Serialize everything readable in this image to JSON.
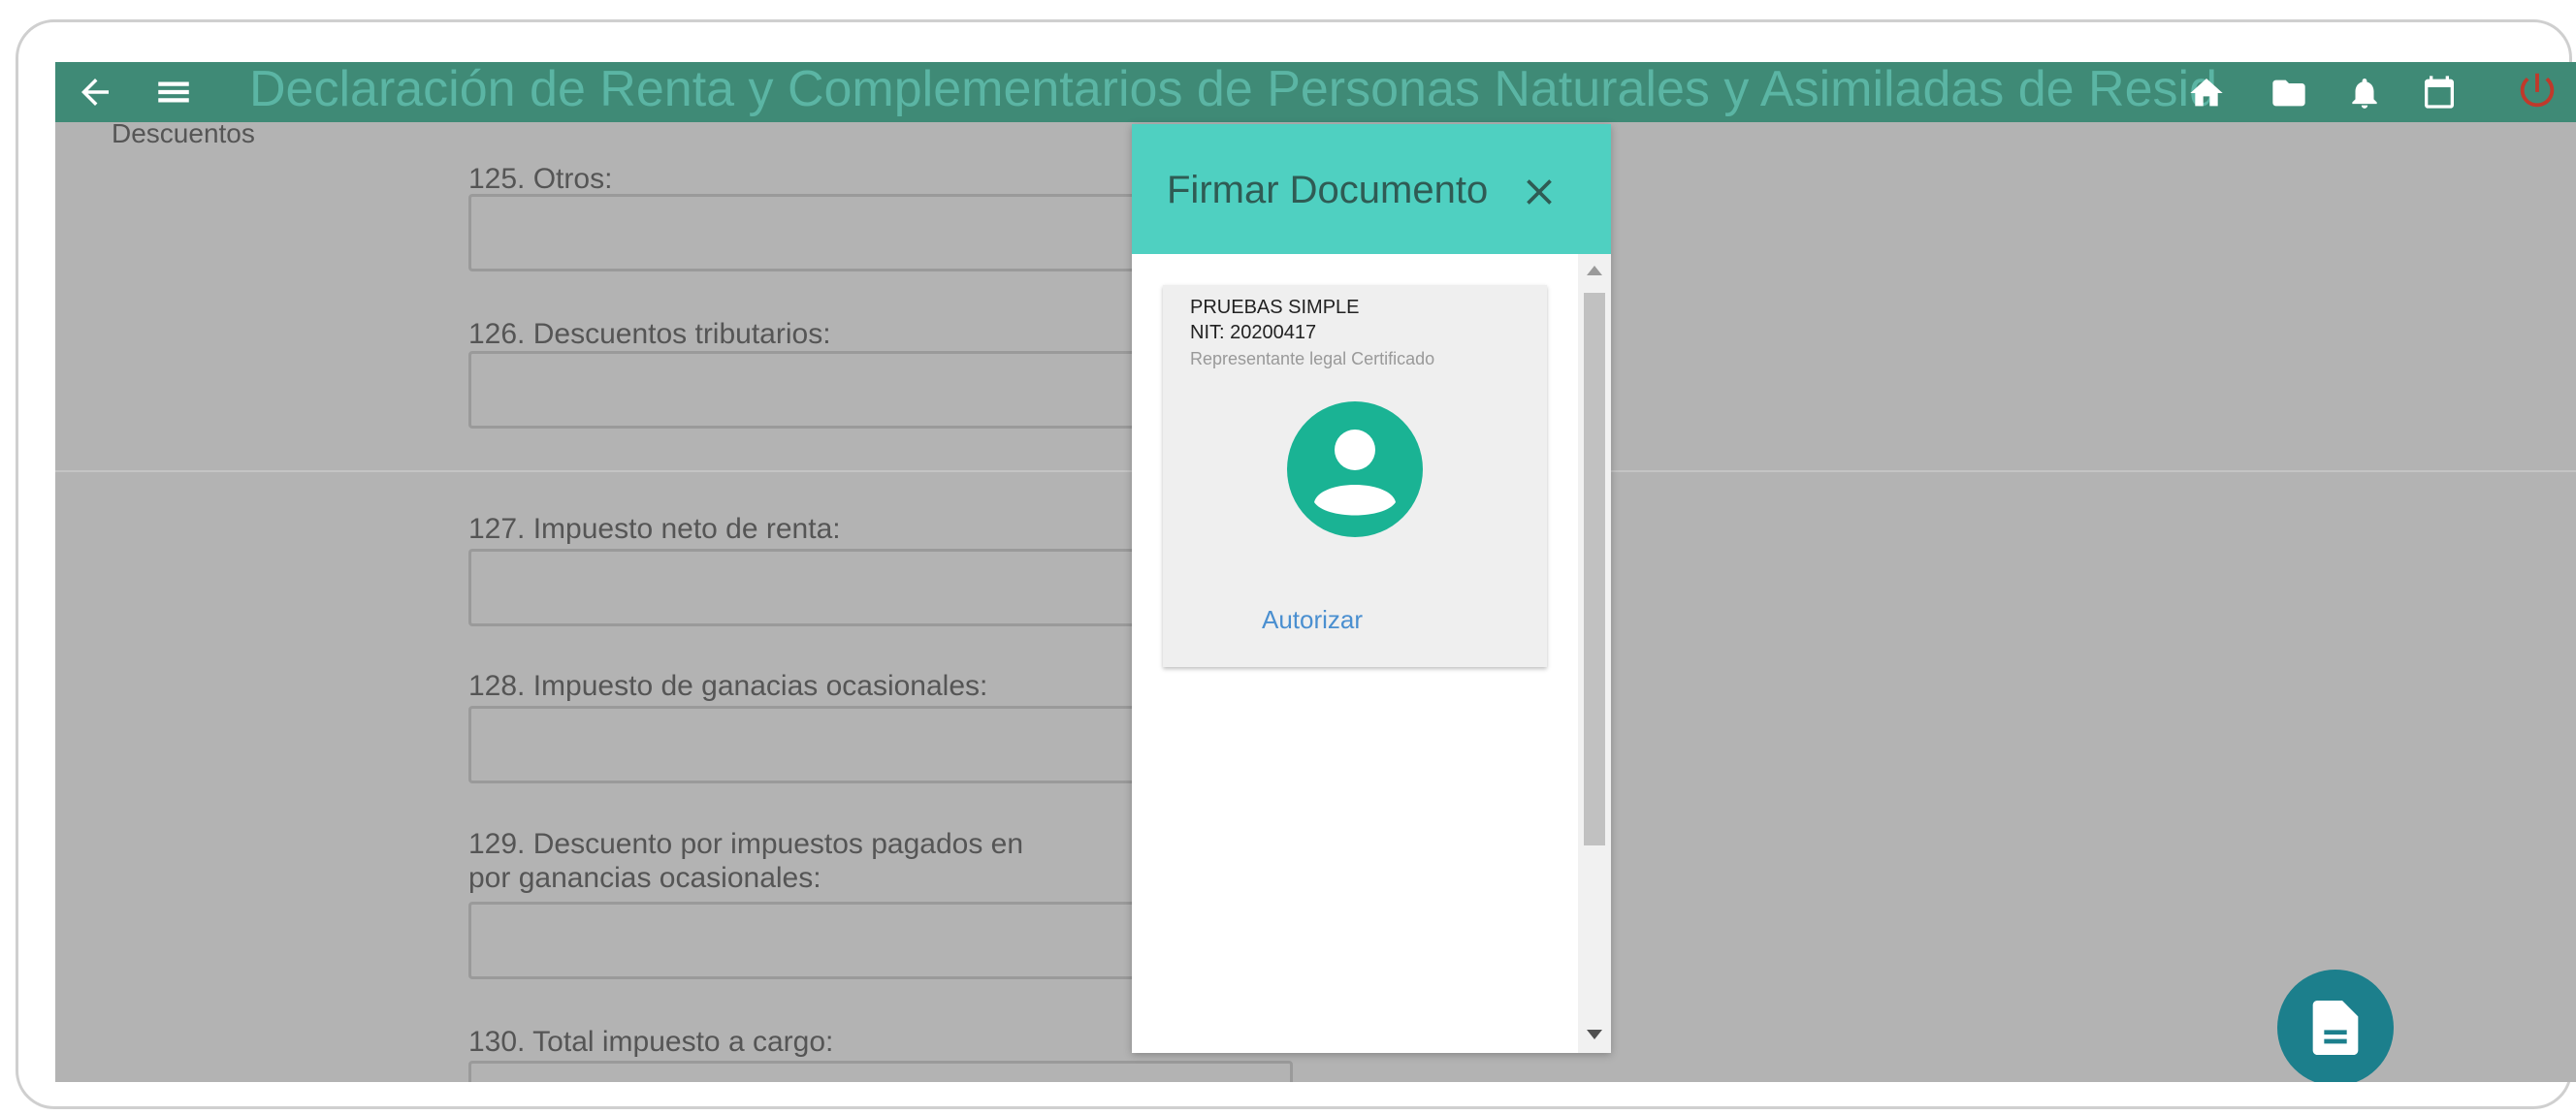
{
  "appbar": {
    "title": "Declaración de Renta y Complementarios de Personas Naturales y Asimiladas de Resid",
    "icons": [
      "back-arrow-icon",
      "menu-icon",
      "home-icon",
      "folder-icon",
      "bell-icon",
      "calendar-icon",
      "power-icon"
    ]
  },
  "section": {
    "label": "Descuentos"
  },
  "fields": [
    {
      "label": "125. Otros:",
      "value": ""
    },
    {
      "label": "126. Descuentos tributarios:",
      "value": ""
    },
    {
      "label": "127. Impuesto neto de renta:",
      "value": ""
    },
    {
      "label": "128. Impuesto de ganacias ocasionales:",
      "value": ""
    },
    {
      "label_line1": "129. Descuento por impuestos pagados en",
      "label_line2": "por ganancias ocasionales:",
      "value": ""
    },
    {
      "label": "130. Total impuesto a cargo:",
      "value": ""
    }
  ],
  "modal": {
    "title": "Firmar Documento",
    "signer": {
      "name": "PRUEBAS  SIMPLE",
      "nit": "NIT:  20200417",
      "role": "Representante legal Certificado",
      "action": "Autorizar"
    }
  },
  "colors": {
    "modal_header": "#4fd0c1",
    "avatar": "#1ab394",
    "link": "#4a8fd0",
    "fab": "#1c7f8c",
    "power": "#c0392b"
  }
}
